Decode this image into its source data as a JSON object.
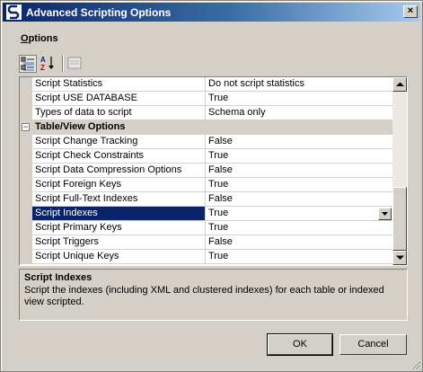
{
  "window": {
    "title": "Advanced Scripting Options",
    "close_glyph": "×"
  },
  "options_label": {
    "accel": "O",
    "rest": "ptions"
  },
  "toolbar": {
    "buttons": [
      {
        "icon": "categorized-icon",
        "active": true
      },
      {
        "icon": "sort-alphabetical-icon",
        "active": false
      },
      {
        "icon": "property-pages-icon",
        "active": false
      }
    ]
  },
  "grid": {
    "rows": [
      {
        "type": "property",
        "name": "Script Statistics",
        "value": "Do not script statistics"
      },
      {
        "type": "property",
        "name": "Script USE DATABASE",
        "value": "True"
      },
      {
        "type": "property",
        "name": "Types of data to script",
        "value": "Schema only"
      },
      {
        "type": "category",
        "name": "Table/View Options",
        "expander": "−"
      },
      {
        "type": "property",
        "name": "Script Change Tracking",
        "value": "False"
      },
      {
        "type": "property",
        "name": "Script Check Constraints",
        "value": "True"
      },
      {
        "type": "property",
        "name": "Script Data Compression Options",
        "value": "False"
      },
      {
        "type": "property",
        "name": "Script Foreign Keys",
        "value": "True"
      },
      {
        "type": "property",
        "name": "Script Full-Text Indexes",
        "value": "False"
      },
      {
        "type": "property",
        "name": "Script Indexes",
        "value": "True",
        "selected": true
      },
      {
        "type": "property",
        "name": "Script Primary Keys",
        "value": "True"
      },
      {
        "type": "property",
        "name": "Script Triggers",
        "value": "False"
      },
      {
        "type": "property",
        "name": "Script Unique Keys",
        "value": "True"
      }
    ]
  },
  "description": {
    "title": "Script Indexes",
    "text": "Script the indexes (including XML and clustered indexes) for each table or indexed view scripted."
  },
  "buttons": {
    "ok": "OK",
    "cancel": "Cancel"
  },
  "colors": {
    "selection": "#0a246a",
    "dialog": "#d4d0c8",
    "title_start": "#0a246a",
    "title_end": "#a6caf0"
  }
}
